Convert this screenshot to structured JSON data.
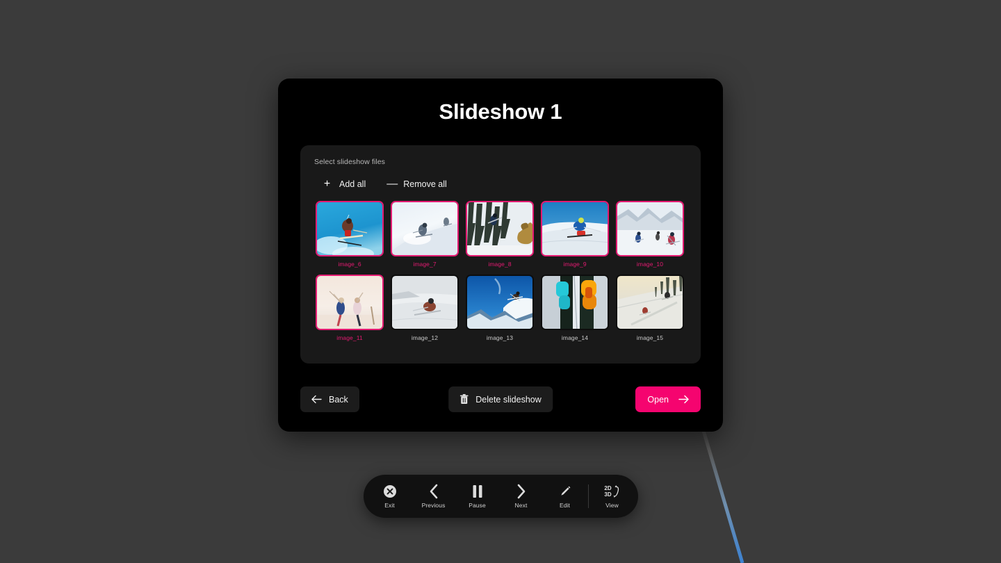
{
  "page": {
    "background_color": "#3b3b3b",
    "connector_gradient_from": "#4a4a4a",
    "connector_gradient_to": "#3d82d1"
  },
  "dialog": {
    "title": "Slideshow 1",
    "background_color": "#000000"
  },
  "panel": {
    "label": "Select slideshow files",
    "bulk_actions": [
      {
        "id": "add-all",
        "icon": "plus-icon",
        "glyph": "+",
        "label": "Add all"
      },
      {
        "id": "remove-all",
        "icon": "minus-icon",
        "glyph": "—",
        "label": "Remove all"
      }
    ],
    "thumbnails": [
      {
        "label": "image_6",
        "selected": true,
        "scene": "skier-airborne-blue-sky"
      },
      {
        "label": "image_7",
        "selected": true,
        "scene": "powder-skier-white-slope"
      },
      {
        "label": "image_8",
        "selected": true,
        "scene": "tree-skiing-forest"
      },
      {
        "label": "image_9",
        "selected": true,
        "scene": "carving-skier-blue-jacket"
      },
      {
        "label": "image_10",
        "selected": true,
        "scene": "group-skiers-mountains"
      },
      {
        "label": "image_11",
        "selected": true,
        "scene": "two-skiers-celebrating-sunset"
      },
      {
        "label": "image_12",
        "selected": false,
        "scene": "skier-turn-grey-slope"
      },
      {
        "label": "image_13",
        "selected": false,
        "scene": "ridge-jump-deep-blue-sky"
      },
      {
        "label": "image_14",
        "selected": false,
        "scene": "ski-goggles-closeup"
      },
      {
        "label": "image_15",
        "selected": false,
        "scene": "golden-hour-tree-run"
      }
    ],
    "selected_color": "#e51a72",
    "unselected_label_color": "#c9c9c9"
  },
  "footer": {
    "back_label": "Back",
    "delete_label": "Delete slideshow",
    "open_label": "Open",
    "open_color": "#f5046f"
  },
  "toolbar": {
    "items": [
      {
        "id": "exit",
        "icon": "close-circle-icon",
        "label": "Exit"
      },
      {
        "id": "previous",
        "icon": "chevron-left-icon",
        "label": "Previous"
      },
      {
        "id": "pause",
        "icon": "pause-icon",
        "label": "Pause"
      },
      {
        "id": "next",
        "icon": "chevron-right-icon",
        "label": "Next"
      },
      {
        "id": "edit",
        "icon": "pencil-icon",
        "label": "Edit"
      },
      {
        "id": "view",
        "icon": "2d-3d-toggle-icon",
        "label": "View",
        "top_text": "2D",
        "bottom_text": "3D"
      }
    ]
  }
}
